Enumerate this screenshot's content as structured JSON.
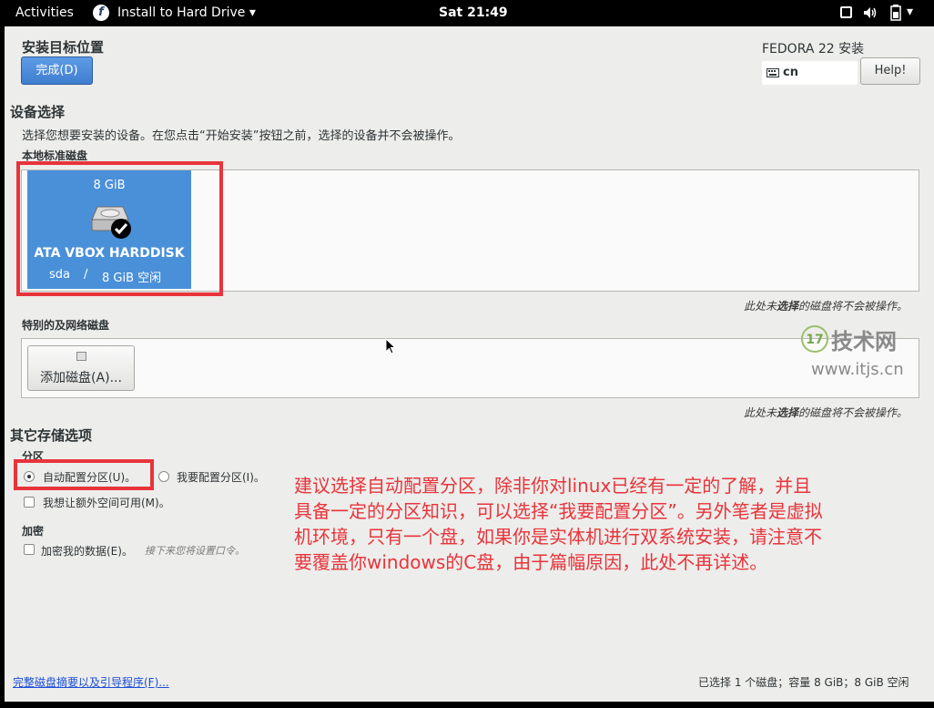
{
  "topbar": {
    "activities": "Activities",
    "app_menu": "Install to Hard Drive",
    "clock": "Sat 21:49"
  },
  "header": {
    "title": "安装目标位置",
    "done_button": "完成(D)",
    "product": "FEDORA 22 安装",
    "keyboard_layout": "cn",
    "help_button": "Help!"
  },
  "device_selection": {
    "heading": "设备选择",
    "description": "选择您想要安装的设备。在您点击“开始安装”按钮之前，选择的设备并不会被操作。",
    "local_disks_label": "本地标准磁盘",
    "disk": {
      "size": "8 GiB",
      "name": "ATA VBOX HARDDISK",
      "device": "sda",
      "slash": "/",
      "free": "8 GiB 空闲"
    },
    "unselected_note_parts": [
      "此处未",
      "选择",
      "的磁盘将不会被操作。"
    ]
  },
  "special_disks": {
    "heading": "特别的及网络磁盘",
    "add_disk_button": "添加磁盘(A)...",
    "unselected_note_parts": [
      "此处未",
      "选择",
      "的磁盘将不会被操作。"
    ]
  },
  "other_storage": {
    "heading": "其它存储选项",
    "partitioning_label": "分区",
    "auto_partition": "自动配置分区(U)。",
    "manual_partition": "我要配置分区(I)。",
    "extra_space": "我想让额外空间可用(M)。",
    "encryption_label": "加密",
    "encrypt_data": "加密我的数据(E)。",
    "encrypt_hint": "接下来您将设置口令。"
  },
  "footer": {
    "summary_link": "完整磁盘摘要以及引导程序(F)...",
    "status": "已选择 1 个磁盘；容量 8 GiB；8 GiB 空闲"
  },
  "annotation": {
    "lines": [
      "建议选择自动配置分区，除非你对linux已经有一定的了解，并且",
      "具备一定的分区知识，可以选择“我要配置分区”。另外笔者是虚拟",
      "机环境，只有一个盘，如果你是实体机进行双系统安装，请注意不",
      "要覆盖你windows的C盘，由于篇幅原因，此处不再详述。"
    ]
  },
  "watermark": {
    "badge": "17",
    "brand": "技术网",
    "url": "www.itjs.cn"
  },
  "colors": {
    "accent": "#4a90d9",
    "highlight": "#e8343b",
    "window_bg": "#ededeb"
  }
}
